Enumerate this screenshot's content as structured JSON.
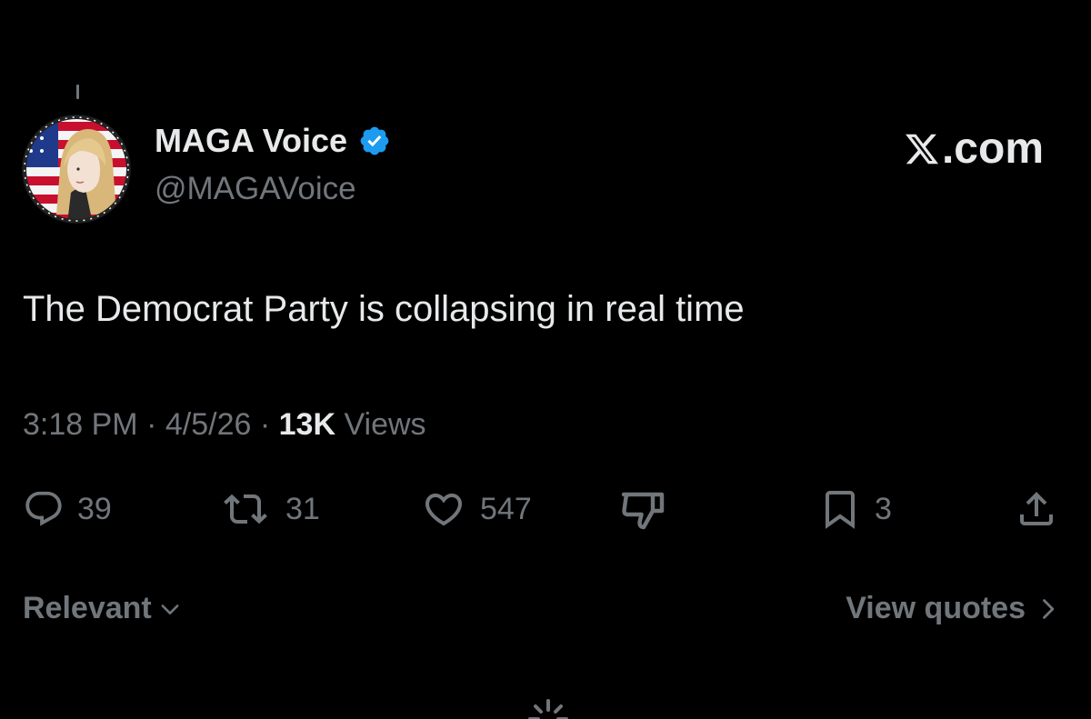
{
  "author": {
    "display_name": "MAGA Voice",
    "handle": "@MAGAVoice",
    "verified": true,
    "avatar_icon": "avatar-woman-flag-icon"
  },
  "watermark": {
    "logo_icon": "x-logo-icon",
    "text": ".com"
  },
  "tweet": {
    "text": "The Democrat Party is collapsing in real time",
    "time": "3:18 PM",
    "separator1": "·",
    "date": "4/5/26",
    "separator2": "·",
    "views_count": "13K",
    "views_label": "Views"
  },
  "actions": {
    "reply": {
      "icon": "reply-icon",
      "count": "39"
    },
    "retweet": {
      "icon": "retweet-icon",
      "count": "31"
    },
    "like": {
      "icon": "heart-icon",
      "count": "547"
    },
    "downvote": {
      "icon": "thumbs-down-icon"
    },
    "bookmark": {
      "icon": "bookmark-icon",
      "count": "3"
    },
    "share": {
      "icon": "share-icon"
    }
  },
  "footer": {
    "sort_label": "Relevant",
    "view_quotes_label": "View quotes"
  },
  "colors": {
    "background": "#000000",
    "primary_text": "#e7e9ea",
    "secondary_text": "#71767b",
    "verified_blue": "#1d9bf0"
  }
}
